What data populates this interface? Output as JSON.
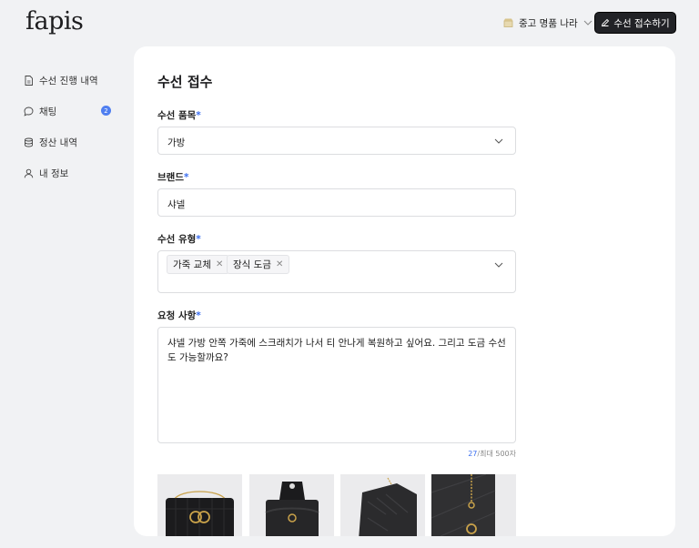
{
  "header": {
    "logo": "fapis",
    "shop_name": "중고 명품 나라",
    "cta_label": "수선 접수하기"
  },
  "sidebar": {
    "items": [
      {
        "label": "수선 진행 내역",
        "icon": "document-icon"
      },
      {
        "label": "채팅",
        "icon": "chat-icon",
        "badge": "2"
      },
      {
        "label": "정산 내역",
        "icon": "database-icon"
      },
      {
        "label": "내 정보",
        "icon": "user-icon"
      }
    ]
  },
  "form": {
    "title": "수선 접수",
    "required_mark": "*",
    "category": {
      "label": "수선 품목",
      "value": "가방"
    },
    "brand": {
      "label": "브랜드",
      "value": "샤넬"
    },
    "repair_type": {
      "label": "수선 유형",
      "tags": [
        "가죽 교체",
        "장식 도금"
      ]
    },
    "request": {
      "label": "요청 사항",
      "value": "샤넬 가방 안쪽 가죽에 스크래치가 나서 티 안나게 복원하고 싶어요. 그리고 도금 수선도 가능할까요?",
      "count": "27",
      "max": "/최대 500자"
    },
    "photos": [
      "bag-front-photo",
      "bag-inside-photo",
      "bag-side-photo",
      "bag-hardware-photo"
    ]
  },
  "colors": {
    "accent": "#3c6ff0",
    "cta_bg": "#212226",
    "page_bg": "#f1f2f4"
  }
}
